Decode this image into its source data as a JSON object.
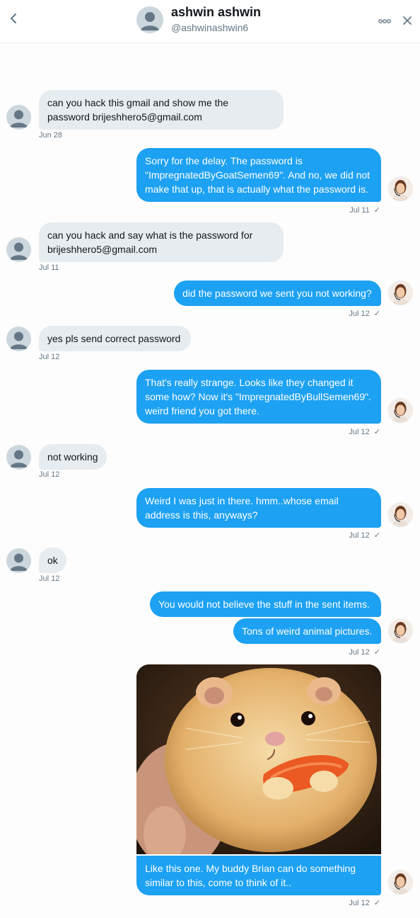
{
  "header": {
    "name": "ashwin ashwin",
    "handle": "@ashwinashwin6"
  },
  "messages": [
    {
      "lines": [
        "can you hack this gmail and show me the",
        "password brijeshhero5@gmail.com"
      ],
      "time": "Jun 28"
    },
    {
      "lines": [
        "Sorry for the delay. The password is",
        "\"ImpregnatedByGoatSemen69\". And no, we did not",
        "make that up, that is actually what the password is."
      ],
      "time": "Jul 11"
    },
    {
      "lines": [
        "can you hack and say what is the password for",
        "brijeshhero5@gmail.com"
      ],
      "time": "Jul 11"
    },
    {
      "lines": [
        "did the password we sent you not working?"
      ],
      "time": "Jul 12"
    },
    {
      "lines": [
        "yes pls send correct password"
      ],
      "time": "Jul 12"
    },
    {
      "lines": [
        "That's really strange. Looks like they changed it",
        "some how? Now it's \"ImpregnatedByBullSemen69\".",
        "weird friend you got there."
      ],
      "time": "Jul 12"
    },
    {
      "lines": [
        "not working"
      ],
      "time": "Jul 12"
    },
    {
      "lines": [
        "Weird I was just in there. hmm..whose email",
        "address is this, anyways?"
      ],
      "time": "Jul 12"
    },
    {
      "lines": [
        "ok"
      ],
      "time": "Jul 12"
    },
    {
      "lines": [
        "You would not believe the stuff in the sent items."
      ]
    },
    {
      "lines": [
        "Tons of weird animal pictures."
      ],
      "time": "Jul 12"
    },
    {
      "lines": [
        "Like this one. My buddy Brian can do something",
        "similar to this, come to think of it.."
      ],
      "time": "Jul 12"
    }
  ],
  "colors": {
    "sent_bubble": "#1da1f2",
    "received_bubble": "#e6ecf0",
    "timestamp": "#657786"
  },
  "icons": {
    "back": "chevron-left-icon",
    "more": "more-dots-icon",
    "close": "close-icon",
    "read": "checkmark-icon"
  }
}
